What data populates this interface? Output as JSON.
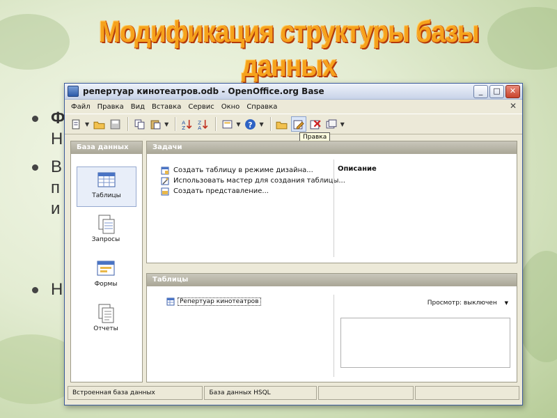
{
  "slide": {
    "title": "Модификация структуры базы данных",
    "bullets": [
      {
        "text": "Ф"
      },
      {
        "text": "Н"
      },
      {
        "text": "В"
      },
      {
        "text": "п"
      },
      {
        "text": "и"
      },
      {
        "text": "Н"
      }
    ]
  },
  "window": {
    "title": "репертуар кинотеатров.odb - OpenOffice.org Base",
    "menu": [
      "Файл",
      "Правка",
      "Вид",
      "Вставка",
      "Сервис",
      "Окно",
      "Справка"
    ],
    "tooltip": "Правка",
    "left_panel": {
      "header": "База данных",
      "items": [
        {
          "label": "Таблицы"
        },
        {
          "label": "Запросы"
        },
        {
          "label": "Формы"
        },
        {
          "label": "Отчеты"
        }
      ]
    },
    "tasks": {
      "header": "Задачи",
      "items": [
        {
          "label": "Создать таблицу в режиме дизайна..."
        },
        {
          "label": "Использовать мастер для создания таблицы..."
        },
        {
          "label": "Создать представление..."
        }
      ],
      "description_label": "Описание"
    },
    "tables": {
      "header": "Таблицы",
      "items": [
        {
          "label": "Репертуар кинотеатров"
        }
      ],
      "preview_label": "Просмотр: выключен"
    },
    "status": [
      "Встроенная база данных",
      "База данных HSQL",
      "",
      ""
    ]
  },
  "colors": {
    "title_fill": "#f6a21c",
    "title_outline": "#b23a0c",
    "panel_header": "#a9a696",
    "window_bg": "#ece9d8"
  }
}
